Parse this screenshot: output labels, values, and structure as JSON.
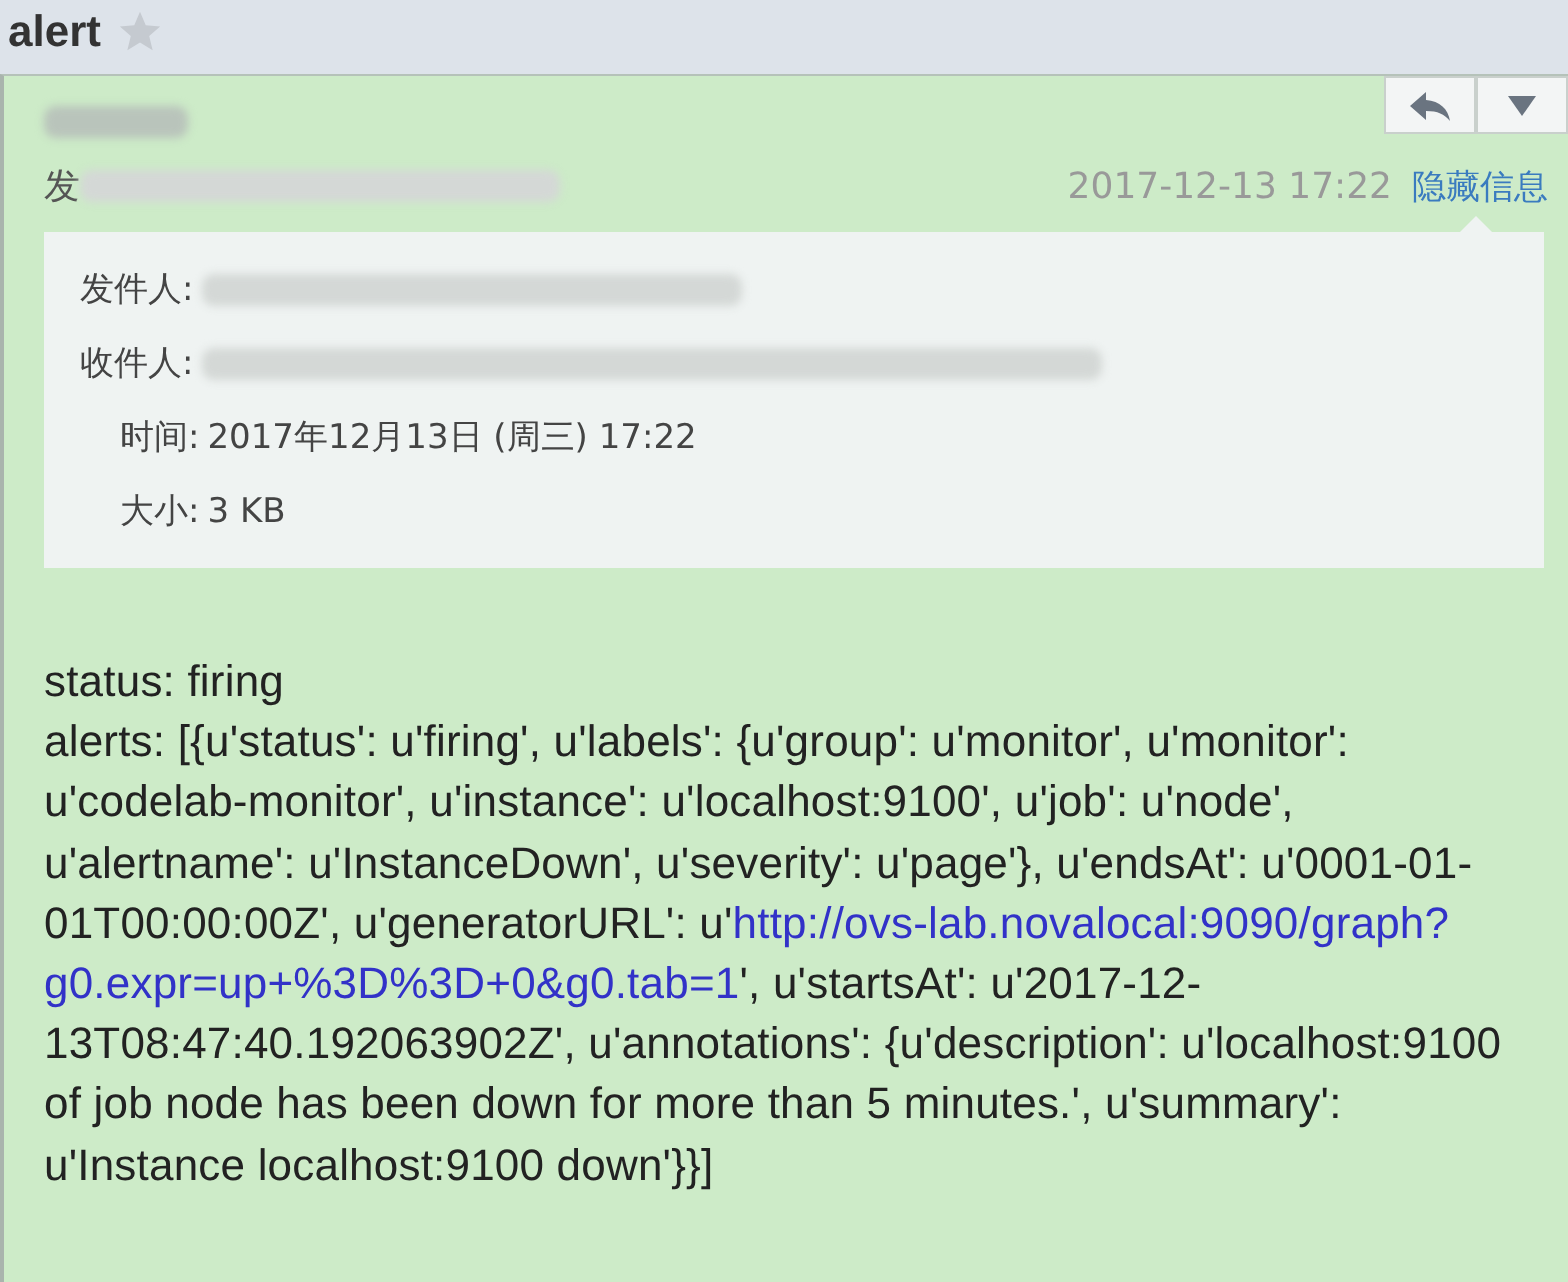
{
  "subject": {
    "title": "alert",
    "starred": false
  },
  "header": {
    "recipient_prefix": "发",
    "date": "2017-12-13 17:22",
    "toggle_link": "隐藏信息"
  },
  "details": [
    {
      "label": "发件人:",
      "kind": "redacted"
    },
    {
      "label": "收件人:",
      "kind": "redacted"
    },
    {
      "label": "时间:",
      "kind": "text",
      "value": "2017年12月13日 (周三) 17:22"
    },
    {
      "label": "大小:",
      "kind": "text",
      "value": "3 KB"
    }
  ],
  "body": [
    [
      {
        "kind": "text",
        "text": "status: firing"
      }
    ],
    [
      {
        "kind": "text",
        "text": "alerts: [{u'status': u'firing', u'labels': {u'group': u'monitor', u'monitor':"
      }
    ],
    [
      {
        "kind": "text",
        "text": "u'codelab-monitor', u'instance': u'localhost:9100', u'job': u'node',"
      }
    ],
    [
      {
        "kind": "text",
        "text": "u'alertname': u'InstanceDown', u'severity': u'page'}, u'endsAt': u'0001-01-"
      }
    ],
    [
      {
        "kind": "text",
        "text": "01T00:00:00Z', u'generatorURL': u'"
      },
      {
        "kind": "link",
        "text": "http://ovs-lab.novalocal:9090/graph?"
      }
    ],
    [
      {
        "kind": "link",
        "text": "g0.expr=up+%3D%3D+0&g0.tab=1"
      },
      {
        "kind": "text",
        "text": "', u'startsAt': u'2017-12-"
      }
    ],
    [
      {
        "kind": "text",
        "text": "13T08:47:40.192063902Z', u'annotations': {u'description': u'localhost:9100"
      }
    ],
    [
      {
        "kind": "text",
        "text": "of job node has been down for more than 5 minutes.', u'summary':"
      }
    ],
    [
      {
        "kind": "text",
        "text": "u'Instance localhost:9100 down'}}]"
      }
    ]
  ]
}
